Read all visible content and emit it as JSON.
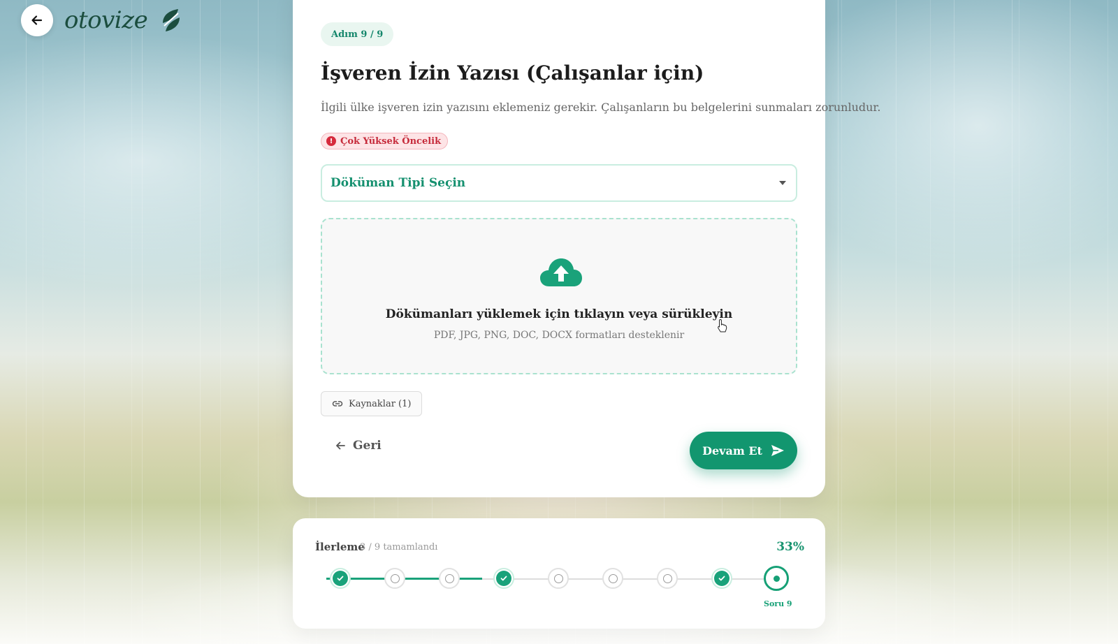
{
  "brand": {
    "name": "otovize"
  },
  "step": {
    "badge": "Adım 9 / 9"
  },
  "question": {
    "title": "İşveren İzin Yazısı (Çalışanlar için)",
    "description": "İlgili ülke işveren izin yazısını eklemeniz gerekir. Çalışanların bu belgelerini sunmaları zorunludur.",
    "priority": "Çok Yüksek Öncelik"
  },
  "document_select": {
    "placeholder": "Döküman Tipi Seçin"
  },
  "upload": {
    "title": "Dökümanları yüklemek için tıklayın veya sürükleyin",
    "formats": "PDF, JPG, PNG, DOC, DOCX formatları desteklenir"
  },
  "sources_button": {
    "label": "Kaynaklar (1)"
  },
  "nav": {
    "back_label": "Geri",
    "continue_label": "Devam Et"
  },
  "progress": {
    "title": "İlerleme",
    "count_text": "3 / 9 tamamlandı",
    "percent_text": "33%",
    "current_label": "Soru 9",
    "steps": [
      "done",
      "todo",
      "todo",
      "done",
      "todo",
      "todo",
      "todo",
      "done",
      "current"
    ]
  },
  "colors": {
    "accent": "#12966f",
    "priority": "#c62b3b",
    "badge_bg": "#e9f6f0"
  }
}
